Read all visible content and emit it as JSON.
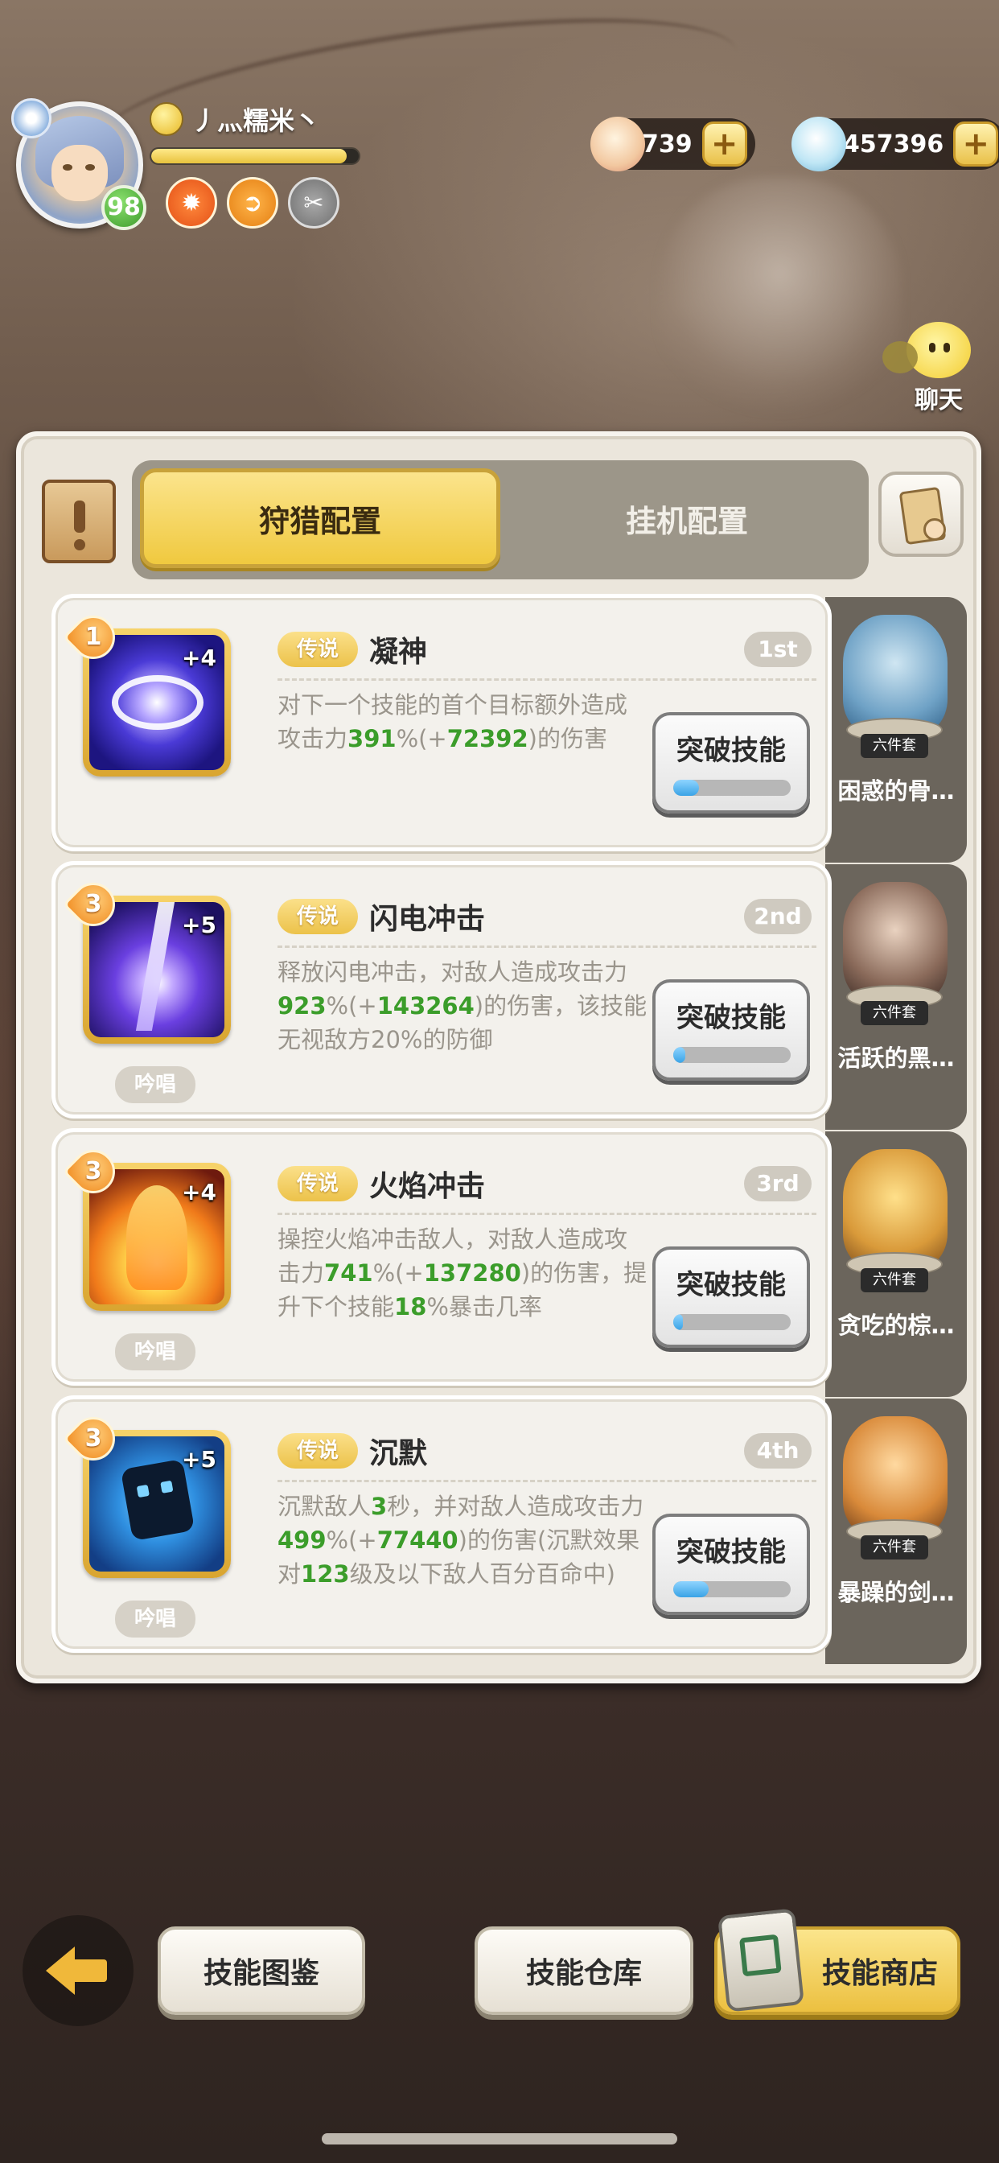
{
  "player": {
    "name": "丿灬糯米丶",
    "level": "98",
    "exp_fraction": 0.94
  },
  "currency": {
    "shells": "739",
    "pearls": "457396",
    "add": "+"
  },
  "chat": {
    "label": "聊天"
  },
  "tabs": {
    "hunt": "狩猎配置",
    "idle": "挂机配置"
  },
  "skills": [
    {
      "level": "1",
      "plus": "+4",
      "rarity": "传说",
      "name": "凝神",
      "rank": "1st",
      "desc_parts": [
        "对下一个技能的首个目标额外造成攻击力",
        "391",
        "%(+",
        "72392",
        ")的伤害"
      ],
      "chant": "",
      "break_label": "突破技能",
      "break_progress": 0.22,
      "pet_name": "困惑的骨…",
      "pet_set": "六件套"
    },
    {
      "level": "3",
      "plus": "+5",
      "rarity": "传说",
      "name": "闪电冲击",
      "rank": "2nd",
      "desc_parts": [
        "释放闪电冲击，对敌人造成攻击力",
        "923",
        "%(+",
        "143264",
        ")的伤害，该技能无视敌方20%的防御"
      ],
      "chant": "吟唱",
      "break_label": "突破技能",
      "break_progress": 0.1,
      "pet_name": "活跃的黑…",
      "pet_set": "六件套"
    },
    {
      "level": "3",
      "plus": "+4",
      "rarity": "传说",
      "name": "火焰冲击",
      "rank": "3rd",
      "desc_parts": [
        "操控火焰冲击敌人，对敌人造成攻击力",
        "741",
        "%(+",
        "137280",
        ")的伤害，提升下个技能",
        "18",
        "%暴击几率"
      ],
      "chant": "吟唱",
      "break_label": "突破技能",
      "break_progress": 0.08,
      "pet_name": "贪吃的棕…",
      "pet_set": "六件套"
    },
    {
      "level": "3",
      "plus": "+5",
      "rarity": "传说",
      "name": "沉默",
      "rank": "4th",
      "desc_parts": [
        "沉默敌人",
        "3",
        "秒，并对敌人造成攻击力",
        "499",
        "%(+",
        "77440",
        ")的伤害(沉默效果对",
        "123",
        "级及以下敌人百分百命中)"
      ],
      "chant": "吟唱",
      "break_label": "突破技能",
      "break_progress": 0.3,
      "pet_name": "暴躁的剑…",
      "pet_set": "六件套"
    }
  ],
  "bottom_nav": {
    "catalog": "技能图鉴",
    "storage": "技能仓库",
    "shop": "技能商店"
  },
  "colors": {
    "accent_yellow": "#f0c93f",
    "highlight_green": "#3b9d2a",
    "panel_bg": "#ebe6dc"
  }
}
